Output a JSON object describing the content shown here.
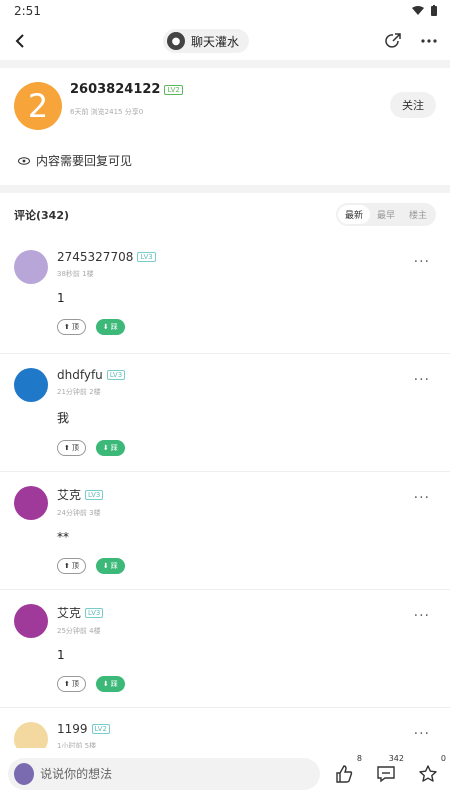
{
  "status": {
    "time": "2:51"
  },
  "topbar": {
    "board_name": "聊天灌水"
  },
  "post": {
    "avatar_text": "2",
    "author": "2603824122",
    "level": "LV2",
    "sub": "6天前 浏览2415 分享0",
    "follow_label": "关注",
    "hidden_notice": "内容需要回复可见"
  },
  "comments_header": {
    "title": "评论(342)",
    "sort": [
      "最新",
      "最早",
      "楼主"
    ]
  },
  "comments": [
    {
      "name": "2745327708",
      "level": "LV3",
      "sub": "38秒前 1楼",
      "text": "1",
      "up": "顶",
      "down": "踩",
      "avatar_color": "#b9a6d8"
    },
    {
      "name": "dhdfyfu",
      "level": "LV3",
      "sub": "21分钟前 2楼",
      "text": "我",
      "up": "顶",
      "down": "踩",
      "avatar_color": "#1f78c8"
    },
    {
      "name": "艾克",
      "level": "LV3",
      "sub": "24分钟前 3楼",
      "text": "**",
      "up": "顶",
      "down": "踩",
      "avatar_color": "#a03a9a"
    },
    {
      "name": "艾克",
      "level": "LV3",
      "sub": "25分钟前 4楼",
      "text": "1",
      "up": "顶",
      "down": "踩",
      "avatar_color": "#a03a9a"
    },
    {
      "name": "1199",
      "level": "LV2",
      "sub": "1小时前 5楼",
      "text": "",
      "up": "",
      "down": "",
      "avatar_color": "#f3d9a0"
    }
  ],
  "bottombar": {
    "placeholder": "说说你的想法",
    "like_count": "8",
    "comment_count": "342",
    "fav_count": "0"
  }
}
